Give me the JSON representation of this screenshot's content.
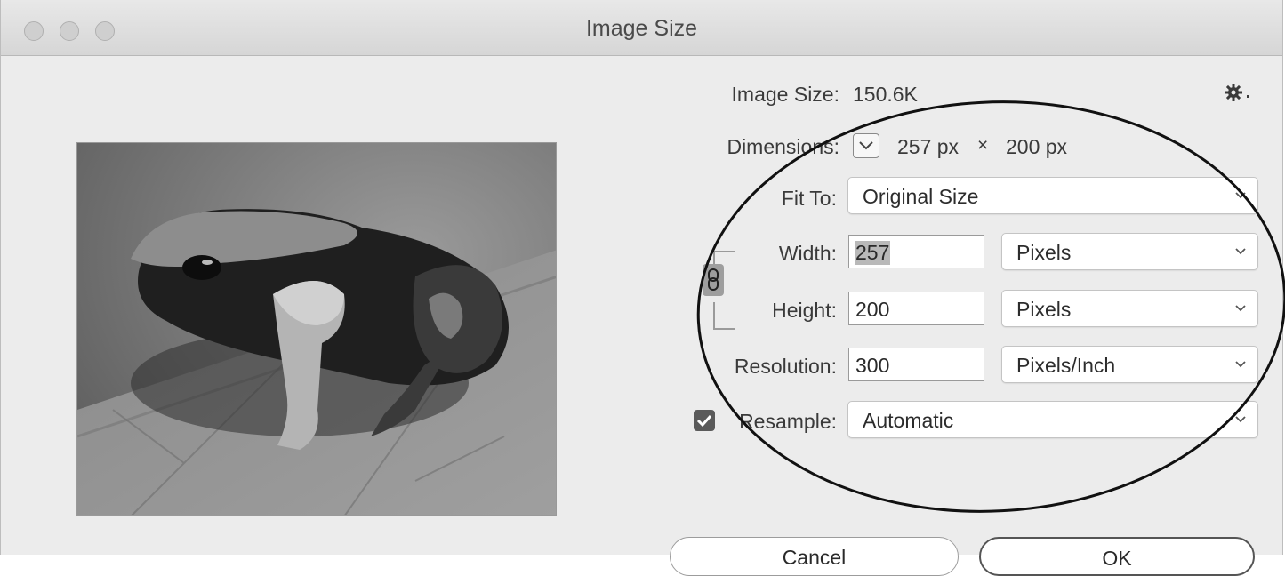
{
  "window": {
    "title": "Image Size"
  },
  "info": {
    "image_size_label": "Image Size:",
    "image_size_value": "150.6K",
    "dimensions_label": "Dimensions:",
    "dimensions_width": "257 px",
    "dimensions_times": "×",
    "dimensions_height": "200 px"
  },
  "fields": {
    "fit_to_label": "Fit To:",
    "fit_to_value": "Original Size",
    "width_label": "Width:",
    "width_value": "257",
    "width_unit": "Pixels",
    "height_label": "Height:",
    "height_value": "200",
    "height_unit": "Pixels",
    "resolution_label": "Resolution:",
    "resolution_value": "300",
    "resolution_unit": "Pixels/Inch",
    "resample_label": "Resample:",
    "resample_checked": true,
    "resample_value": "Automatic"
  },
  "buttons": {
    "cancel": "Cancel",
    "ok": "OK"
  },
  "icons": {
    "settings": "gear-icon",
    "dimensions_menu": "chevron-down-icon",
    "constrain": "chain-link-icon",
    "checkbox": "checkmark-icon"
  }
}
